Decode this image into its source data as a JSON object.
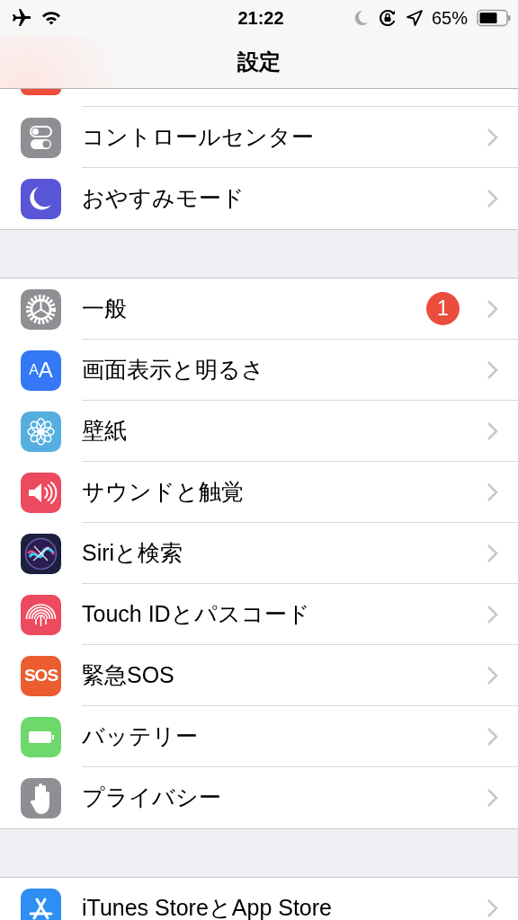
{
  "status_bar": {
    "time": "21:22",
    "battery_percent": "65%"
  },
  "nav_bar": {
    "title": "設定"
  },
  "groups": [
    {
      "partial_row": {
        "kind": "notifications"
      },
      "items": [
        {
          "kind": "controls",
          "label": "コントロールセンター"
        },
        {
          "kind": "moon",
          "label": "おやすみモード"
        }
      ]
    },
    {
      "items": [
        {
          "kind": "gear",
          "label": "一般",
          "badge": "1"
        },
        {
          "kind": "display",
          "label": "画面表示と明るさ",
          "icon_label": "AA"
        },
        {
          "kind": "wallpaper",
          "label": "壁紙"
        },
        {
          "kind": "sound",
          "label": "サウンドと触覚"
        },
        {
          "kind": "siri",
          "label": "Siriと検索"
        },
        {
          "kind": "touchid",
          "label": "Touch IDとパスコード"
        },
        {
          "kind": "sos",
          "label": "緊急SOS",
          "icon_label": "SOS"
        },
        {
          "kind": "battery",
          "label": "バッテリー"
        },
        {
          "kind": "privacy",
          "label": "プライバシー"
        }
      ]
    },
    {
      "items": [
        {
          "kind": "appstore",
          "label": "iTunes StoreとApp Store"
        }
      ]
    }
  ]
}
